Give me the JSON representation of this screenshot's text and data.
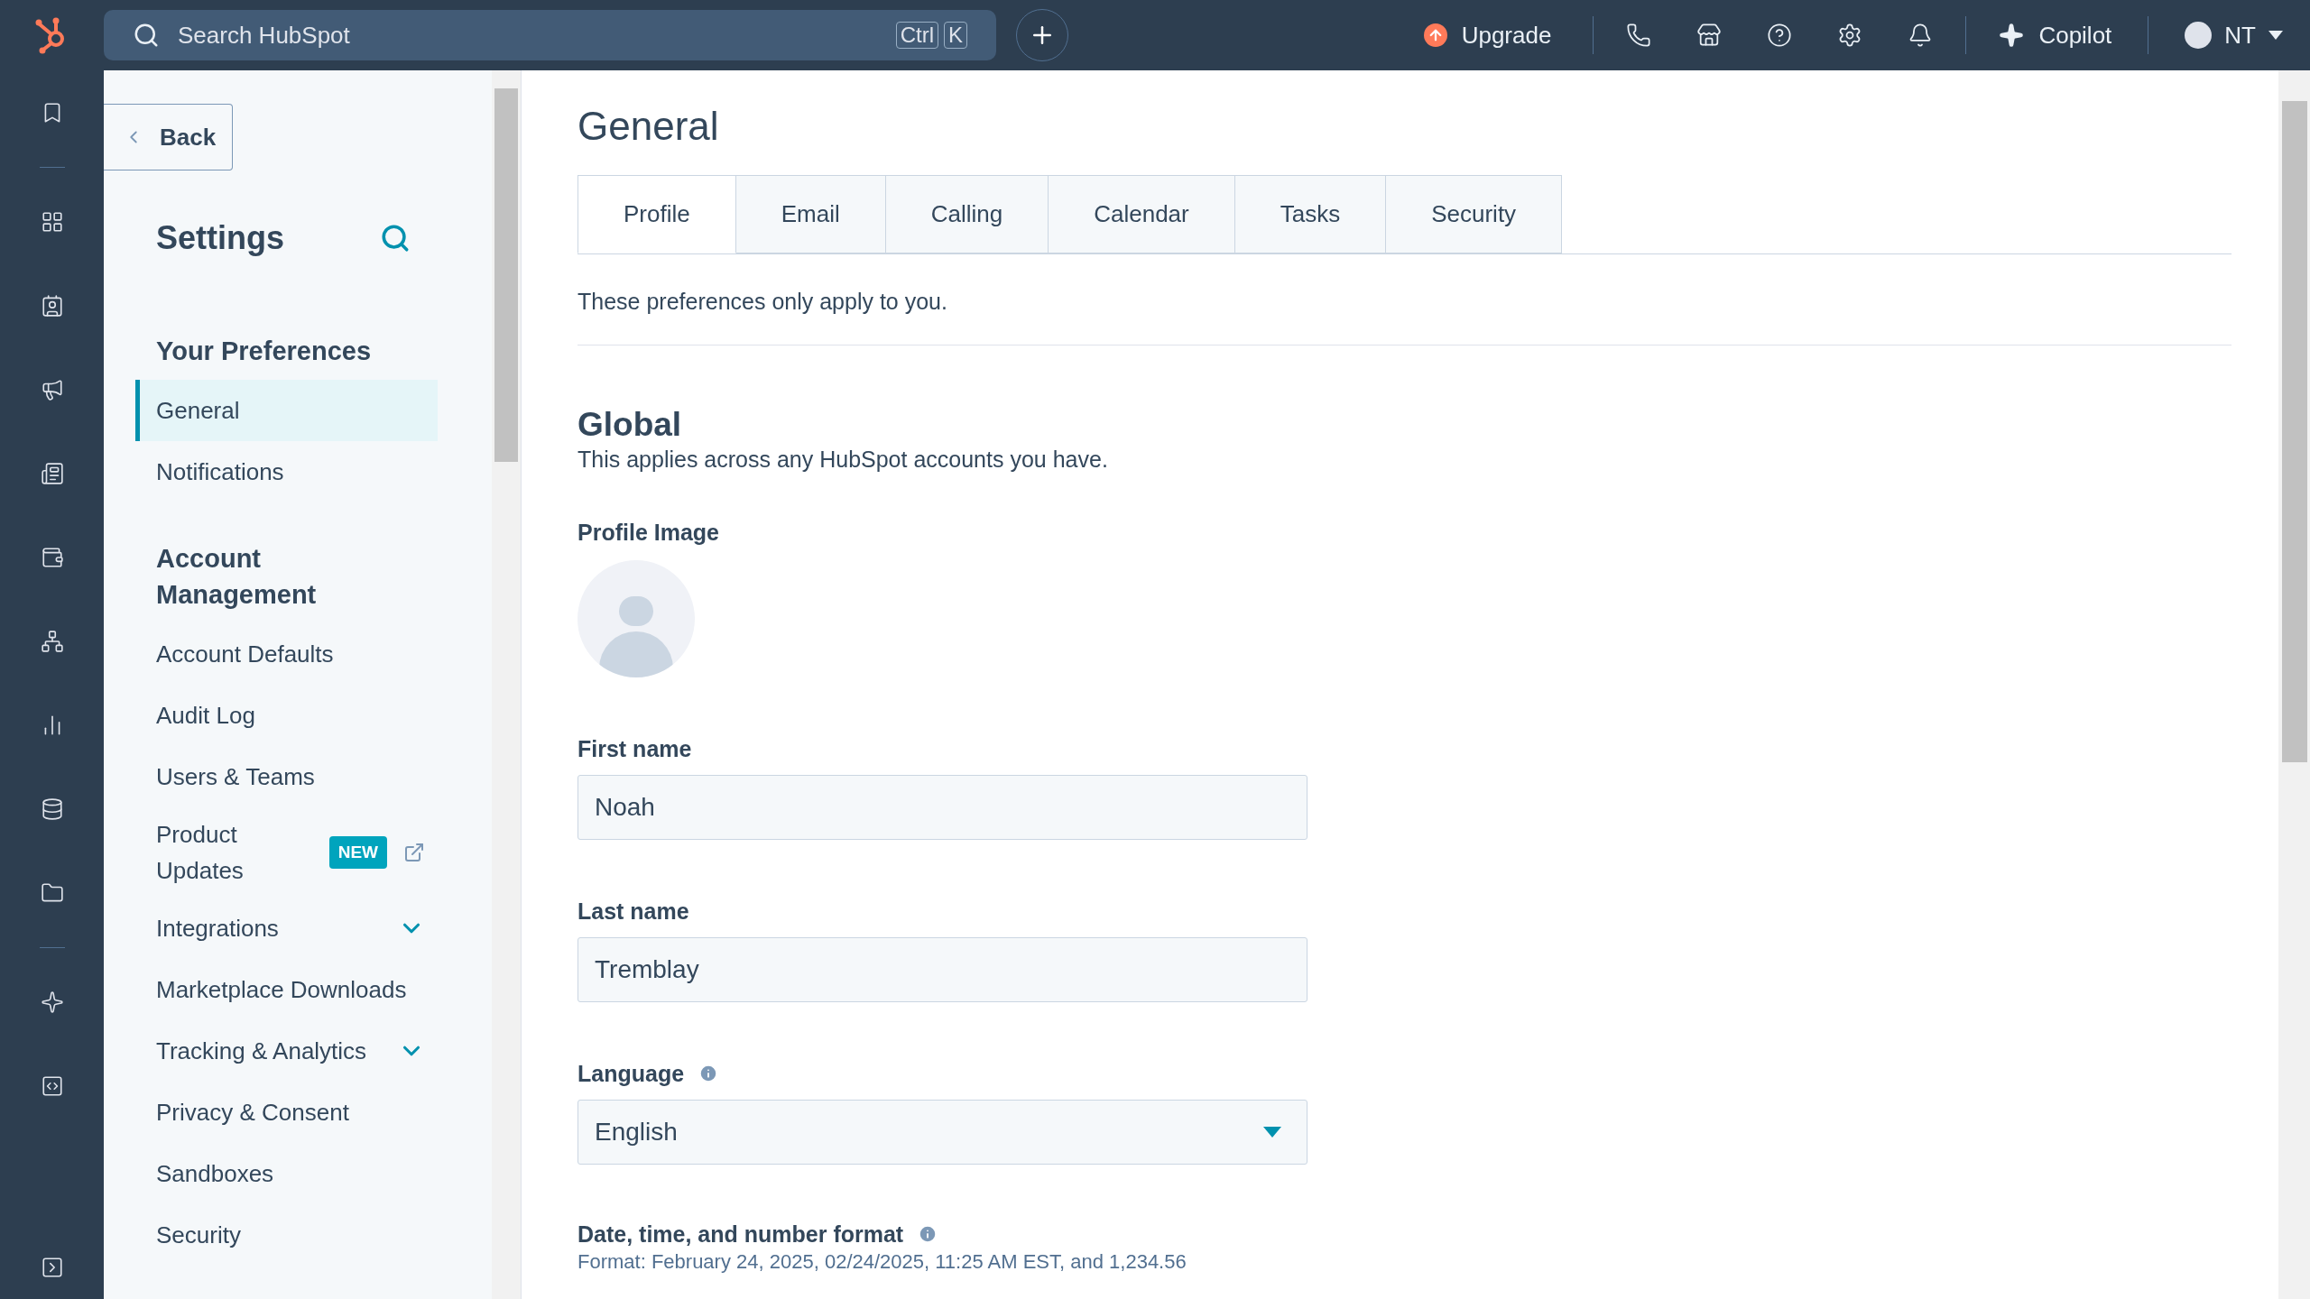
{
  "top_bar": {
    "search": {
      "placeholder": "Search HubSpot",
      "keys": [
        "Ctrl",
        "K"
      ]
    },
    "upgrade": "Upgrade",
    "copilot": "Copilot",
    "user": "NT"
  },
  "sidebar": {
    "back": "Back",
    "title": "Settings",
    "sections": [
      {
        "heading": "Your Preferences",
        "items": [
          {
            "label": "General",
            "kind": "link",
            "selected": true
          },
          {
            "label": "Notifications",
            "kind": "link",
            "selected": false
          }
        ]
      },
      {
        "heading": "Account Management",
        "items": [
          {
            "label": "Account Defaults",
            "kind": "link",
            "selected": false
          },
          {
            "label": "Audit Log",
            "kind": "link",
            "selected": false
          },
          {
            "label": "Users & Teams",
            "kind": "link",
            "selected": false
          },
          {
            "label": "Product Updates",
            "kind": "external",
            "badge": "NEW",
            "selected": false
          },
          {
            "label": "Integrations",
            "kind": "expandable",
            "selected": false
          },
          {
            "label": "Marketplace Downloads",
            "kind": "link",
            "selected": false
          },
          {
            "label": "Tracking & Analytics",
            "kind": "expandable",
            "selected": false
          },
          {
            "label": "Privacy & Consent",
            "kind": "link",
            "selected": false
          },
          {
            "label": "Sandboxes",
            "kind": "link",
            "selected": false
          },
          {
            "label": "Security",
            "kind": "link",
            "selected": false
          }
        ]
      }
    ]
  },
  "main": {
    "title": "General",
    "tabs": [
      {
        "label": "Profile",
        "selected": true
      },
      {
        "label": "Email",
        "selected": false
      },
      {
        "label": "Calling",
        "selected": false
      },
      {
        "label": "Calendar",
        "selected": false
      },
      {
        "label": "Tasks",
        "selected": false
      },
      {
        "label": "Security",
        "selected": false
      }
    ],
    "note": "These preferences only apply to you.",
    "section": {
      "heading": "Global",
      "description": "This applies across any HubSpot accounts you have."
    },
    "profile_image": {
      "label": "Profile Image"
    },
    "fields": [
      {
        "kind": "text",
        "label": "First name",
        "value": "Noah",
        "info": false
      },
      {
        "kind": "text",
        "label": "Last name",
        "value": "Tremblay",
        "info": false
      },
      {
        "kind": "select",
        "label": "Language",
        "value": "English",
        "info": true
      }
    ],
    "format": {
      "label": "Date, time, and number format",
      "info": true,
      "text": "Format: February 24, 2025, 02/24/2025, 11:25 AM EST, and 1,234.56"
    }
  }
}
